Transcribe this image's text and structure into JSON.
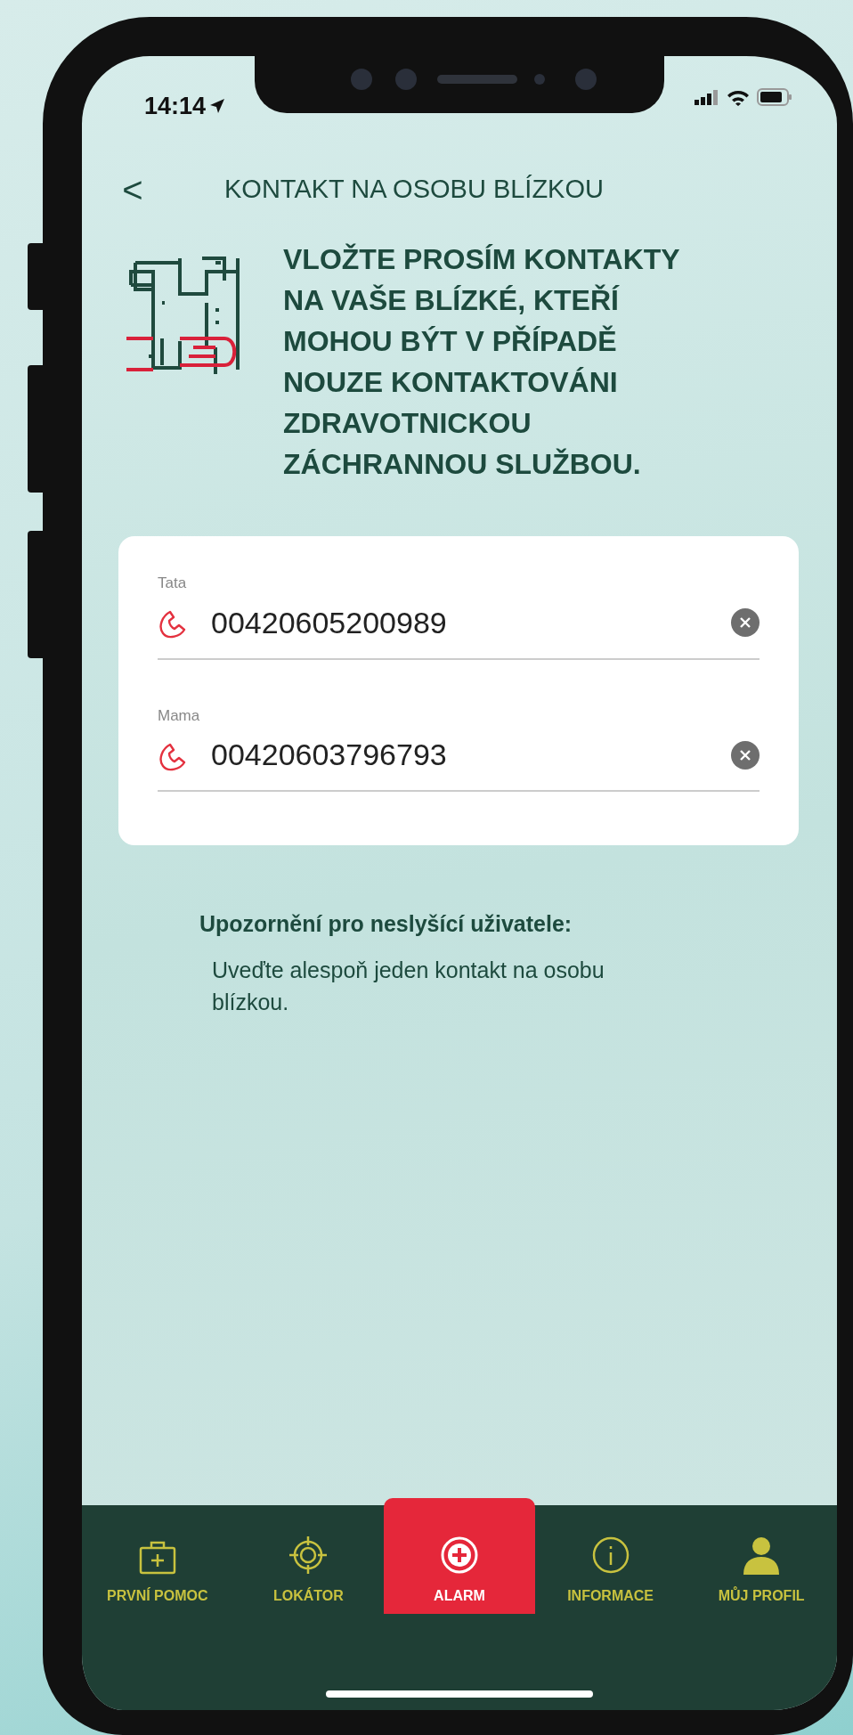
{
  "status_bar": {
    "time": "14:14"
  },
  "header": {
    "back": "<",
    "title": "KONTAKT NA OSOBU BLÍZKOU"
  },
  "intro": {
    "text": "VLOŽTE PROSÍM KONTAKTY NA VAŠE BLÍZKÉ, KTEŘÍ MOHOU BÝT V PŘÍPADĚ NOUZE KONTAKTOVÁNI ZDRAVOTNICKOU ZÁCHRANNOU SLUŽBOU."
  },
  "contacts": [
    {
      "label": "Tata",
      "value": "00420605200989"
    },
    {
      "label": "Mama",
      "value": "00420603796793"
    }
  ],
  "notice": {
    "title": "Upozornění pro neslyšící uživatele:",
    "text": "Uveďte alespoň jeden kontakt na osobu blízkou."
  },
  "tab_bar": [
    {
      "kind": "first-aid",
      "label": "PRVNÍ POMOC",
      "selected": false
    },
    {
      "kind": "locator",
      "label": "LOKÁTOR",
      "selected": false
    },
    {
      "kind": "alarm",
      "label": "ALARM",
      "selected": true
    },
    {
      "kind": "info",
      "label": "INFORMACE",
      "selected": false
    },
    {
      "kind": "profile",
      "label": "MŮJ PROFIL",
      "selected": false
    }
  ]
}
